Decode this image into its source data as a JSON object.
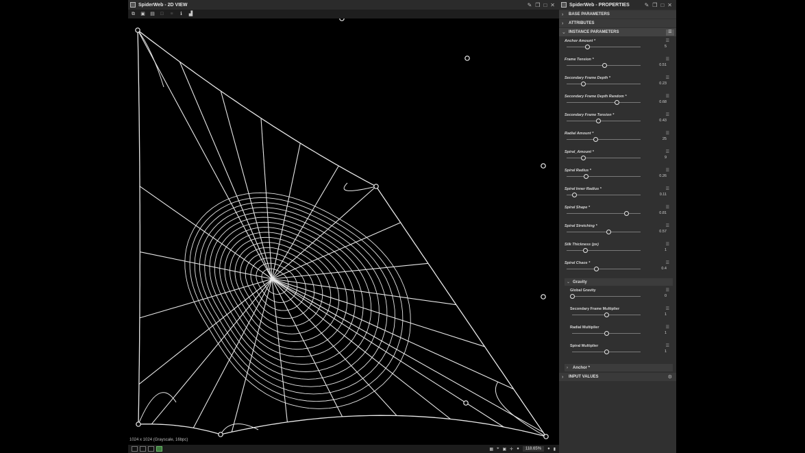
{
  "view2d": {
    "title": "SpiderWeb - 2D VIEW",
    "status_text": "1024 x 1024 (Grayscale, 16bpc)",
    "zoom_level": "118.65%",
    "toolbar_icons": [
      "copy-icon",
      "save-icon",
      "save-as-icon",
      "crop-icon",
      "info-icon",
      "histogram-icon"
    ]
  },
  "properties": {
    "title": "SpiderWeb - PROPERTIES",
    "sections": {
      "base": "BASE PARAMETERS",
      "attributes": "ATTRIBUTES",
      "instance": "INSTANCE PARAMETERS",
      "input_values": "INPUT VALUES"
    },
    "params": [
      {
        "label": "Anchor Amount *",
        "value": "5",
        "pos": 0.28
      },
      {
        "label": "Frame Tension *",
        "value": "0.51",
        "pos": 0.51
      },
      {
        "label": "Secondary Frame Depth *",
        "value": "0.23",
        "pos": 0.23
      },
      {
        "label": "Secondary Frame Depth Random *",
        "value": "0.68",
        "pos": 0.68
      },
      {
        "label": "Secondary Frame Tension *",
        "value": "0.43",
        "pos": 0.43
      },
      {
        "label": "Radial Amount *",
        "value": "25",
        "pos": 0.39
      },
      {
        "label": "Spiral_Amount *",
        "value": "9",
        "pos": 0.23
      },
      {
        "label": "Spiral Radius *",
        "value": "0.26",
        "pos": 0.26
      },
      {
        "label": "Spiral Inner Radius *",
        "value": "0.11",
        "pos": 0.11
      },
      {
        "label": "Spiral Shape *",
        "value": "0.81",
        "pos": 0.81
      },
      {
        "label": "Spiral Stretching *",
        "value": "0.57",
        "pos": 0.57
      },
      {
        "label": "Silk Thickness (px)",
        "value": "1",
        "pos": 0.25
      },
      {
        "label": "Spiral Chaos *",
        "value": "0.4",
        "pos": 0.4
      }
    ],
    "gravity": {
      "label": "Gravity",
      "params": [
        {
          "label": "Global Gravity",
          "value": "0",
          "pos": 0.0
        },
        {
          "label": "Secondary Frame Multiplier",
          "value": "1",
          "pos": 0.5
        },
        {
          "label": "Radial Multiplier",
          "value": "1",
          "pos": 0.5
        },
        {
          "label": "Spiral Multiplier",
          "value": "1",
          "pos": 0.5
        }
      ]
    },
    "anchor_label": "Anchor *"
  },
  "colors": {
    "panel_bg": "#303030",
    "titlebar_bg": "#2b2b2b",
    "web_stroke": "#e9e9e9",
    "canvas_bg": "#000000"
  }
}
